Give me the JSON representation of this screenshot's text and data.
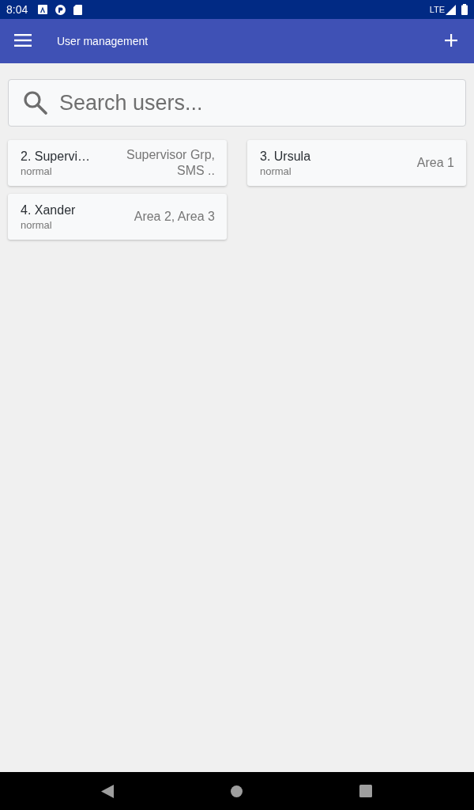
{
  "status_bar": {
    "time": "8:04",
    "network": "LTE"
  },
  "app_bar": {
    "title": "User management"
  },
  "search": {
    "placeholder": "Search users..."
  },
  "users": [
    {
      "name": "2. Supervi…",
      "role": "normal",
      "groups": "Supervisor Grp, SMS .."
    },
    {
      "name": "3. Ursula",
      "role": "normal",
      "groups": "Area 1"
    },
    {
      "name": "4. Xander",
      "role": "normal",
      "groups": "Area 2, Area 3"
    }
  ]
}
